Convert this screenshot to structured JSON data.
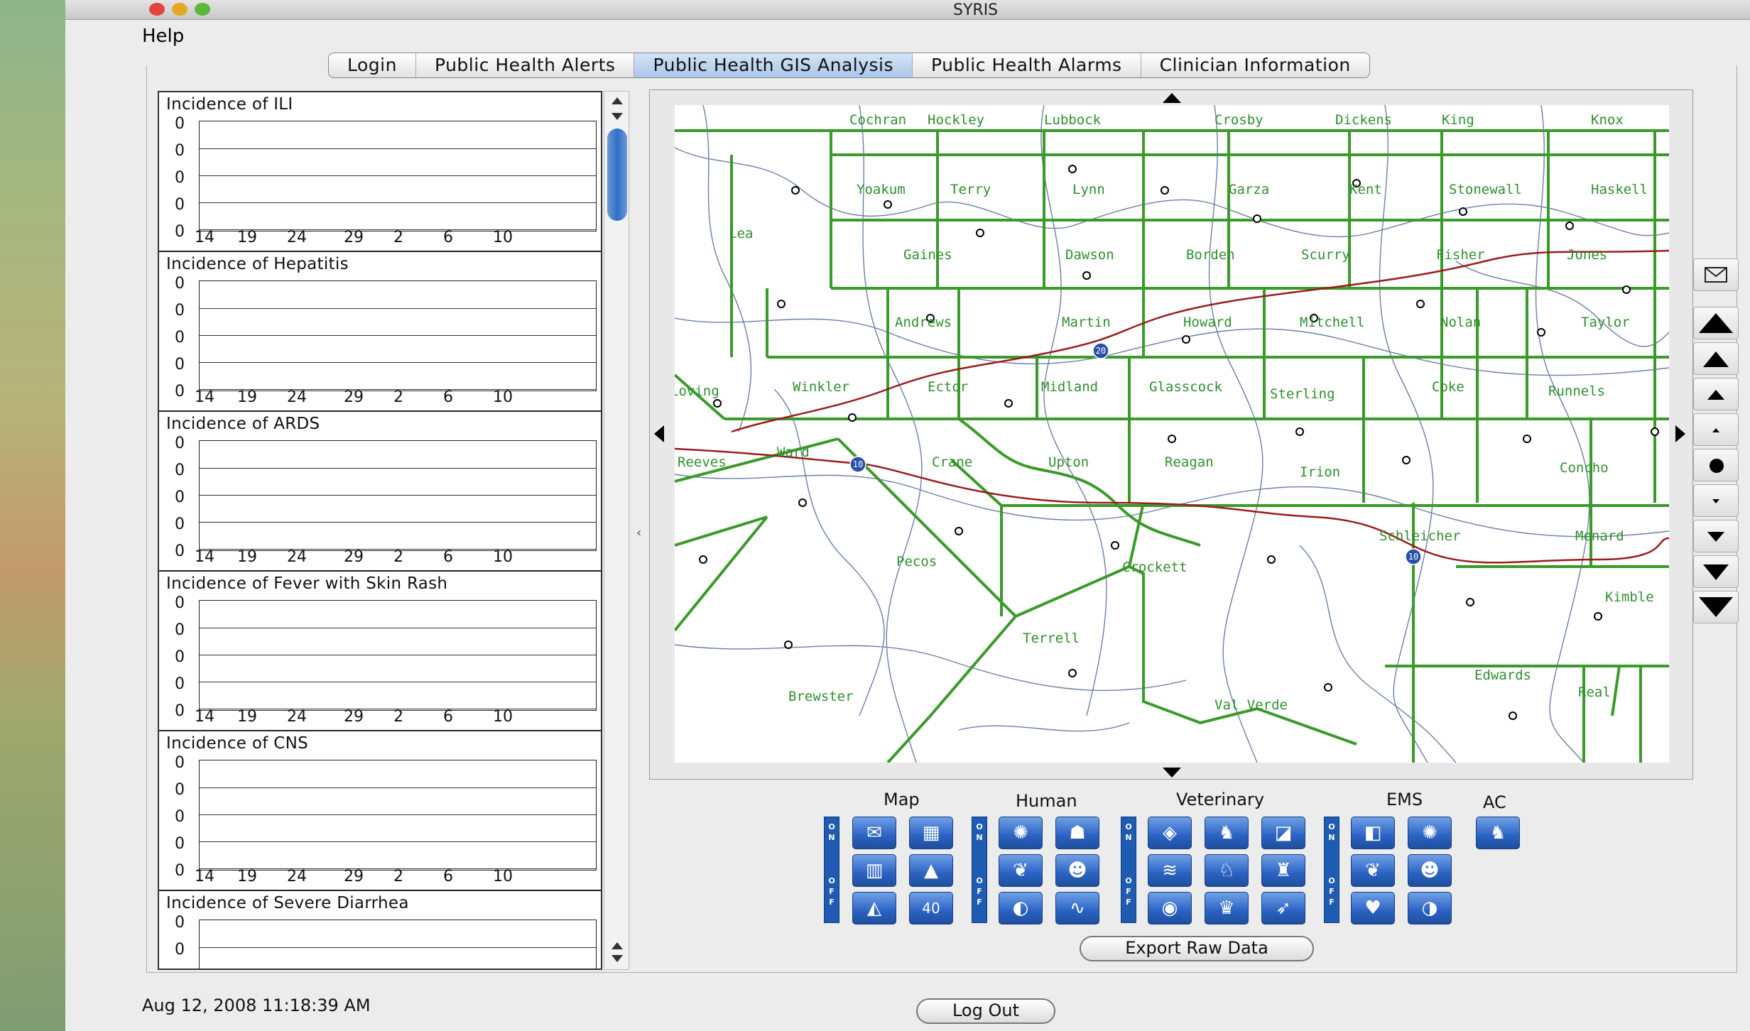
{
  "window": {
    "title": "SYRIS"
  },
  "menu": {
    "help": "Help"
  },
  "tabs": [
    {
      "label": "Login"
    },
    {
      "label": "Public Health Alerts"
    },
    {
      "label": "Public Health GIS Analysis",
      "active": true
    },
    {
      "label": "Public Health Alarms"
    },
    {
      "label": "Clinician Information"
    }
  ],
  "charts": [
    {
      "title": "Incidence of ILI"
    },
    {
      "title": "Incidence of Hepatitis"
    },
    {
      "title": "Incidence of ARDS"
    },
    {
      "title": "Incidence of Fever with Skin Rash"
    },
    {
      "title": "Incidence of CNS"
    },
    {
      "title": "Incidence of Severe Diarrhea"
    }
  ],
  "chart_axis": {
    "y_ticks": [
      "0",
      "0",
      "0",
      "0",
      "0"
    ],
    "x_ticks": [
      "14",
      "19",
      "24",
      "29",
      "2",
      "6",
      "10"
    ]
  },
  "map": {
    "counties": [
      "Cochran",
      "Hockley",
      "Lubbock",
      "Crosby",
      "Dickens",
      "King",
      "Knox",
      "Yoakum",
      "Terry",
      "Lynn",
      "Garza",
      "Kent",
      "Stonewall",
      "Haskell",
      "Lea",
      "Gaines",
      "Dawson",
      "Borden",
      "Scurry",
      "Fisher",
      "Jones",
      "Andrews",
      "Martin",
      "Howard",
      "Mitchell",
      "Nolan",
      "Taylor",
      "Loving",
      "Winkler",
      "Ector",
      "Midland",
      "Glasscock",
      "Sterling",
      "Coke",
      "Runnels",
      "Reeves",
      "Ward",
      "Crane",
      "Upton",
      "Reagan",
      "Irion",
      "Concho",
      "Pecos",
      "Schleicher",
      "Menard",
      "Crockett",
      "Kimble",
      "Terrell",
      "Brewster",
      "Val Verde",
      "Edwards",
      "Real"
    ],
    "highway_labels": [
      "20",
      "10",
      "10"
    ]
  },
  "layer_groups": {
    "map": "Map",
    "human": "Human",
    "veterinary": "Veterinary",
    "ems": "EMS",
    "ac": "AC",
    "on_label": "ON",
    "off_label": "OFF"
  },
  "buttons": {
    "export": "Export Raw Data",
    "logout": "Log Out"
  },
  "status": {
    "datetime": "Aug 12, 2008 11:18:39 AM"
  },
  "colors": {
    "county_border": "#3a9a2a",
    "county_label": "#2f8f2f",
    "highway": "#9a1c1c",
    "roads": "#6a7fa8",
    "active_tab": "#a9c7ea",
    "layer_button": "#2a62c2"
  }
}
